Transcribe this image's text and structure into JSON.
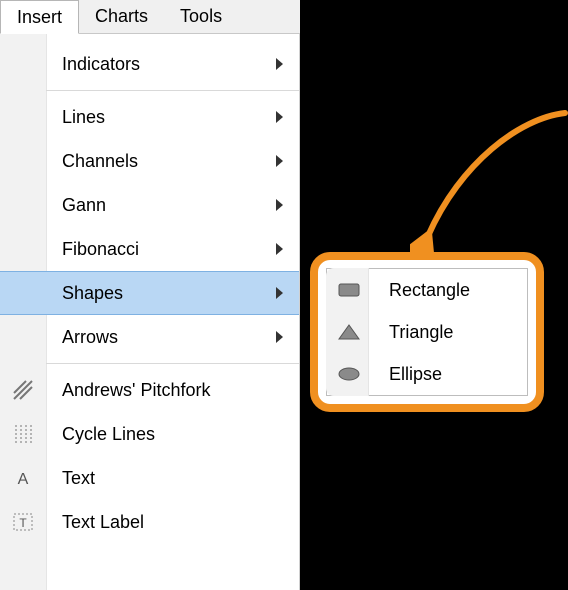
{
  "menubar": {
    "items": [
      {
        "label": "Insert",
        "active": true
      },
      {
        "label": "Charts",
        "active": false
      },
      {
        "label": "Tools",
        "active": false
      }
    ]
  },
  "dropdown": {
    "groups": [
      [
        {
          "label": "Indicators",
          "submenu": true
        }
      ],
      [
        {
          "label": "Lines",
          "submenu": true
        },
        {
          "label": "Channels",
          "submenu": true
        },
        {
          "label": "Gann",
          "submenu": true
        },
        {
          "label": "Fibonacci",
          "submenu": true
        },
        {
          "label": "Shapes",
          "submenu": true,
          "highlight": true
        },
        {
          "label": "Arrows",
          "submenu": true
        }
      ],
      [
        {
          "label": "Andrews' Pitchfork",
          "icon": "pitchfork"
        },
        {
          "label": "Cycle Lines",
          "icon": "cycle-lines"
        },
        {
          "label": "Text",
          "icon": "text-a"
        },
        {
          "label": "Text Label",
          "icon": "text-label"
        }
      ]
    ]
  },
  "shapes_submenu": {
    "items": [
      {
        "label": "Rectangle",
        "icon": "rectangle"
      },
      {
        "label": "Triangle",
        "icon": "triangle"
      },
      {
        "label": "Ellipse",
        "icon": "ellipse"
      }
    ]
  },
  "annotation": {
    "arrow_color": "#f09020"
  }
}
